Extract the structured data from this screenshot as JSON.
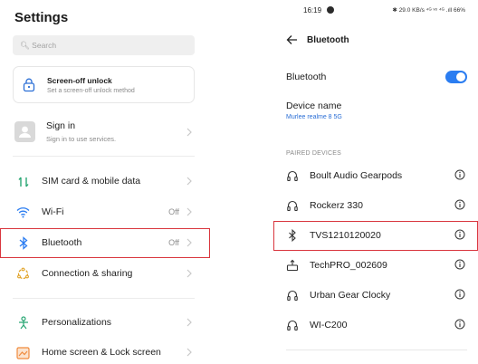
{
  "left": {
    "title": "Settings",
    "search_placeholder": "Search",
    "screen_off": {
      "title": "Screen-off unlock",
      "subtitle": "Set a screen-off unlock method"
    },
    "signin": {
      "title": "Sign in",
      "subtitle": "Sign in to use services."
    },
    "items": [
      {
        "label": "SIM card & mobile data",
        "value": ""
      },
      {
        "label": "Wi-Fi",
        "value": "Off"
      },
      {
        "label": "Bluetooth",
        "value": "Off"
      },
      {
        "label": "Connection & sharing",
        "value": ""
      },
      {
        "label": "Personalizations",
        "value": ""
      },
      {
        "label": "Home screen & Lock screen",
        "value": ""
      }
    ]
  },
  "right": {
    "status": {
      "time": "16:19",
      "icons": "✱ 29.0 KB/s ⁴ᴳ ᵛᵒ ⁴ᴳ .ıll 66%"
    },
    "title": "Bluetooth",
    "bluetooth_label": "Bluetooth",
    "bluetooth_on": true,
    "device_name": {
      "label": "Device name",
      "value": "Murlee realme 8 5G"
    },
    "section": "PAIRED DEVICES",
    "devices": [
      {
        "label": "Boult Audio Gearpods",
        "icon": "headphones-icon"
      },
      {
        "label": "Rockerz 330",
        "icon": "headphones-icon"
      },
      {
        "label": "TVS1210120020",
        "icon": "bluetooth-icon"
      },
      {
        "label": "TechPRO_002609",
        "icon": "input-device-icon"
      },
      {
        "label": "Urban Gear Clocky",
        "icon": "headphones-icon"
      },
      {
        "label": "WI-C200",
        "icon": "headphones-icon"
      }
    ]
  },
  "colors": {
    "accent": "#2b7df1",
    "highlight": "#d9363e"
  }
}
